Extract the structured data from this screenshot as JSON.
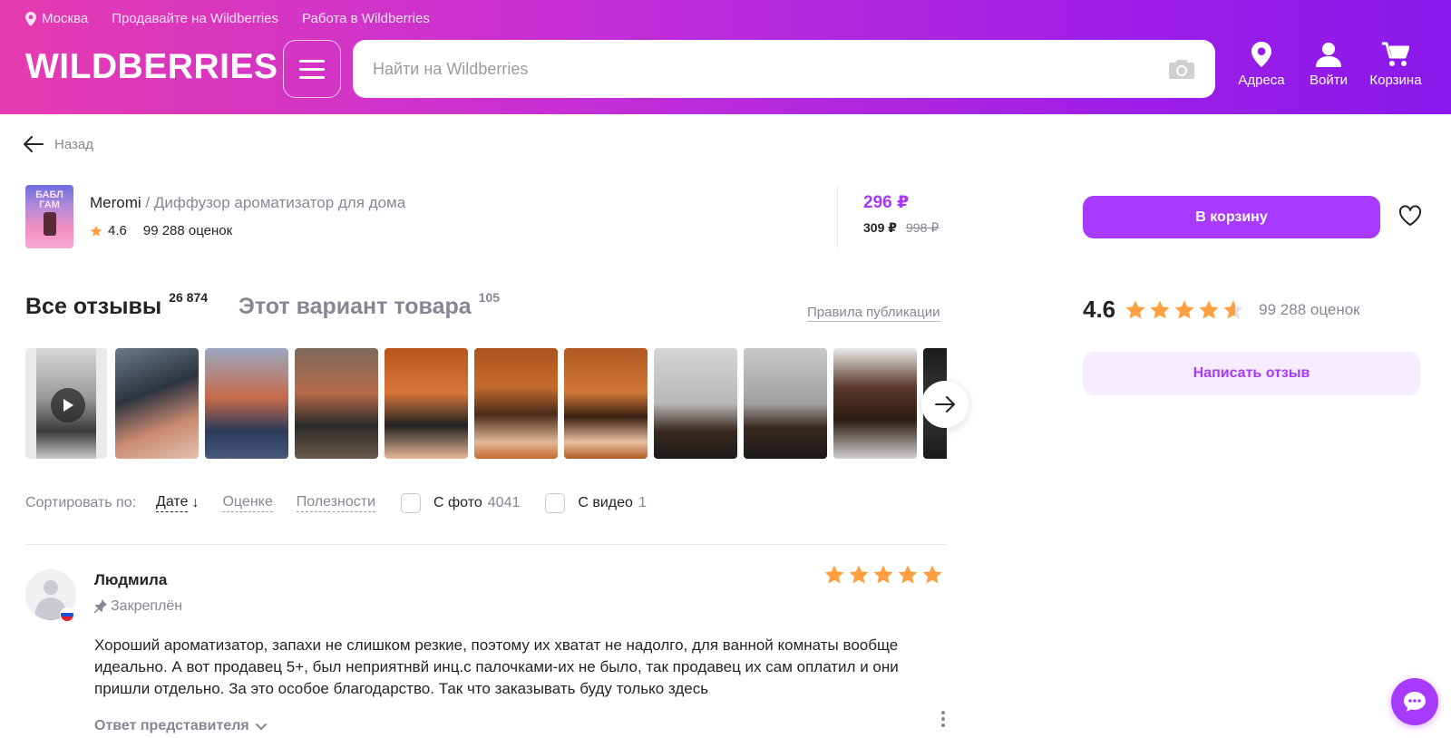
{
  "header": {
    "location": "Москва",
    "sell_link": "Продавайте на Wildberries",
    "jobs_link": "Работа в Wildberries",
    "logo": "WILDBERRIES",
    "search_placeholder": "Найти на Wildberries",
    "nav": {
      "addresses": "Адреса",
      "login": "Войти",
      "cart": "Корзина"
    },
    "colors": {
      "gradient_start": "#e63bb0",
      "gradient_end": "#8a18ec"
    }
  },
  "back_label": "Назад",
  "product": {
    "brand": "Meromi",
    "separator": " / ",
    "name": "Диффузор ароматизатор для дома",
    "thumb_text": "БАБЛ ГАМ",
    "rating": "4.6",
    "ratings_count": "99 288 оценок",
    "price": "296 ₽",
    "wallet_price": "309 ₽",
    "old_price": "998 ₽"
  },
  "actions": {
    "add_to_cart": "В корзину",
    "write_review": "Написать отзыв"
  },
  "tabs": {
    "all_reviews": "Все отзывы",
    "all_reviews_count": "26 874",
    "this_variant": "Этот вариант товара",
    "this_variant_count": "105",
    "rules": "Правила публикации"
  },
  "summary": {
    "rating": "4.6",
    "stars": 4.6,
    "count": "99 288 оценок"
  },
  "sort": {
    "label": "Сортировать по:",
    "by_date": "Дате",
    "by_rating": "Оценке",
    "by_usefulness": "Полезности",
    "with_photo": "С фото",
    "with_photo_count": "4041",
    "with_video": "С видео",
    "with_video_count": "1"
  },
  "review": {
    "author": "Людмила",
    "pinned": "Закреплён",
    "stars": 5,
    "text": "Хороший ароматизатор, запахи не слишком резкие, поэтому их хватат не надолго, для ванной комнаты вообще идеально. А вот продавец 5+, был неприятнвй инц.с палочками-их не было, так продавец их сам оплатил и они пришли отдельно. За это особое благодарство. Так что заказывать буду только здесь",
    "reply_label": "Ответ представителя"
  },
  "accent_color": "#a73afd",
  "star_color": "#ff9f40"
}
